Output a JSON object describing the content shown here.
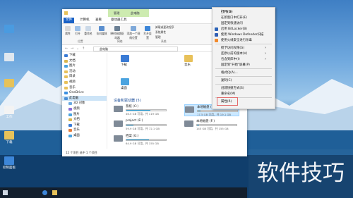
{
  "desktop": {
    "icons": [
      {
        "label": "",
        "name": "computer-icon"
      },
      {
        "label": "",
        "name": "recycle-bin-icon"
      },
      {
        "label": "",
        "name": "folder-icon"
      },
      {
        "label": "工作",
        "name": "file-icon"
      },
      {
        "label": "下载",
        "name": "folder-icon"
      },
      {
        "label": "控制面板",
        "name": "control-panel-icon"
      }
    ]
  },
  "window": {
    "title": "此电脑",
    "context_tab": "管理",
    "tabs": [
      "文件",
      "计算机",
      "查看",
      "驱动器工具"
    ],
    "ribbon": {
      "items": [
        "属性",
        "打开",
        "重命名",
        "访问媒体",
        "映射网络驱动器",
        "添加一个网络位置",
        "打开设置",
        "卸载或更改程序",
        "系统属性",
        "管理"
      ],
      "groups": [
        "位置",
        "网络",
        "系统"
      ]
    },
    "address": {
      "path": "此电脑"
    },
    "nav": [
      {
        "label": "下载",
        "color": "#3a7bd5"
      },
      {
        "label": "文档",
        "color": "#d9b64e"
      },
      {
        "label": "图片",
        "color": "#4aa3df"
      },
      {
        "label": "活动",
        "color": "#e8c15a"
      },
      {
        "label": "目录",
        "color": "#e8c15a"
      },
      {
        "label": "视频",
        "color": "#e8c15a"
      },
      {
        "label": "音乐",
        "color": "#e8c15a"
      },
      {
        "label": "OneDrive",
        "color": "#3b8fe0"
      },
      {
        "label": "此电脑",
        "color": "#4b8fd6"
      },
      {
        "label": "3D 对象",
        "color": "#6aa9e0"
      },
      {
        "label": "视频",
        "color": "#8a6bd6"
      },
      {
        "label": "图片",
        "color": "#4aa3df"
      },
      {
        "label": "文档",
        "color": "#d9b64e"
      },
      {
        "label": "下载",
        "color": "#3a7bd5"
      },
      {
        "label": "音乐",
        "color": "#e57c3a"
      },
      {
        "label": "桌面",
        "color": "#4aa3df"
      }
    ],
    "folders": [
      {
        "label": "下载",
        "color": "#3a7bd5"
      },
      {
        "label": "音乐",
        "color": "#e8c15a"
      },
      {
        "label": "桌面",
        "color": "#4aa3df"
      }
    ],
    "section_title": "设备和驱动器 (5)",
    "drives": [
      {
        "name": "系统 (C:)",
        "size": "46.5 GB 可用，共 119 GB",
        "used": 0.61
      },
      {
        "name": "本地磁盘 (D:)",
        "size": "17.5 GB 可用，共 19.1 GB",
        "used": 0.08
      },
      {
        "name": "project (E:)",
        "size": "59.9 GB 可用，共 72.1 GB",
        "used": 0.17
      },
      {
        "name": "本地磁盘 (F:)",
        "size": "145 GB 可用，共 155 GB",
        "used": 0.06
      },
      {
        "name": "档案 (G:)",
        "size": "64.9 GB 可用，共 155 GB",
        "used": 0.58
      }
    ],
    "status": "12 个项目  选中 1 个项目"
  },
  "menu": {
    "items": [
      {
        "label": "打开(O)"
      },
      {
        "label": "在新窗口中打开(E)"
      },
      {
        "label": "固定到快速访问"
      },
      {
        "label": "启用 BitLocker(B)"
      },
      {
        "label": "使用 Windows Defender扫描"
      },
      {
        "label": "使用火绒安全进行杀毒"
      },
      {
        "label": "授予访问权限(G)"
      },
      {
        "label": "还原以前的版本(V)"
      },
      {
        "label": "包含到库中(I)"
      },
      {
        "label": "固定到\"开始\"屏幕(P)"
      },
      {
        "label": "格式化(A)..."
      },
      {
        "label": "复制(C)"
      },
      {
        "label": "创建快捷方式(S)"
      },
      {
        "label": "重命名(M)"
      },
      {
        "label": "属性(R)"
      }
    ]
  },
  "watermark": "软件技巧"
}
